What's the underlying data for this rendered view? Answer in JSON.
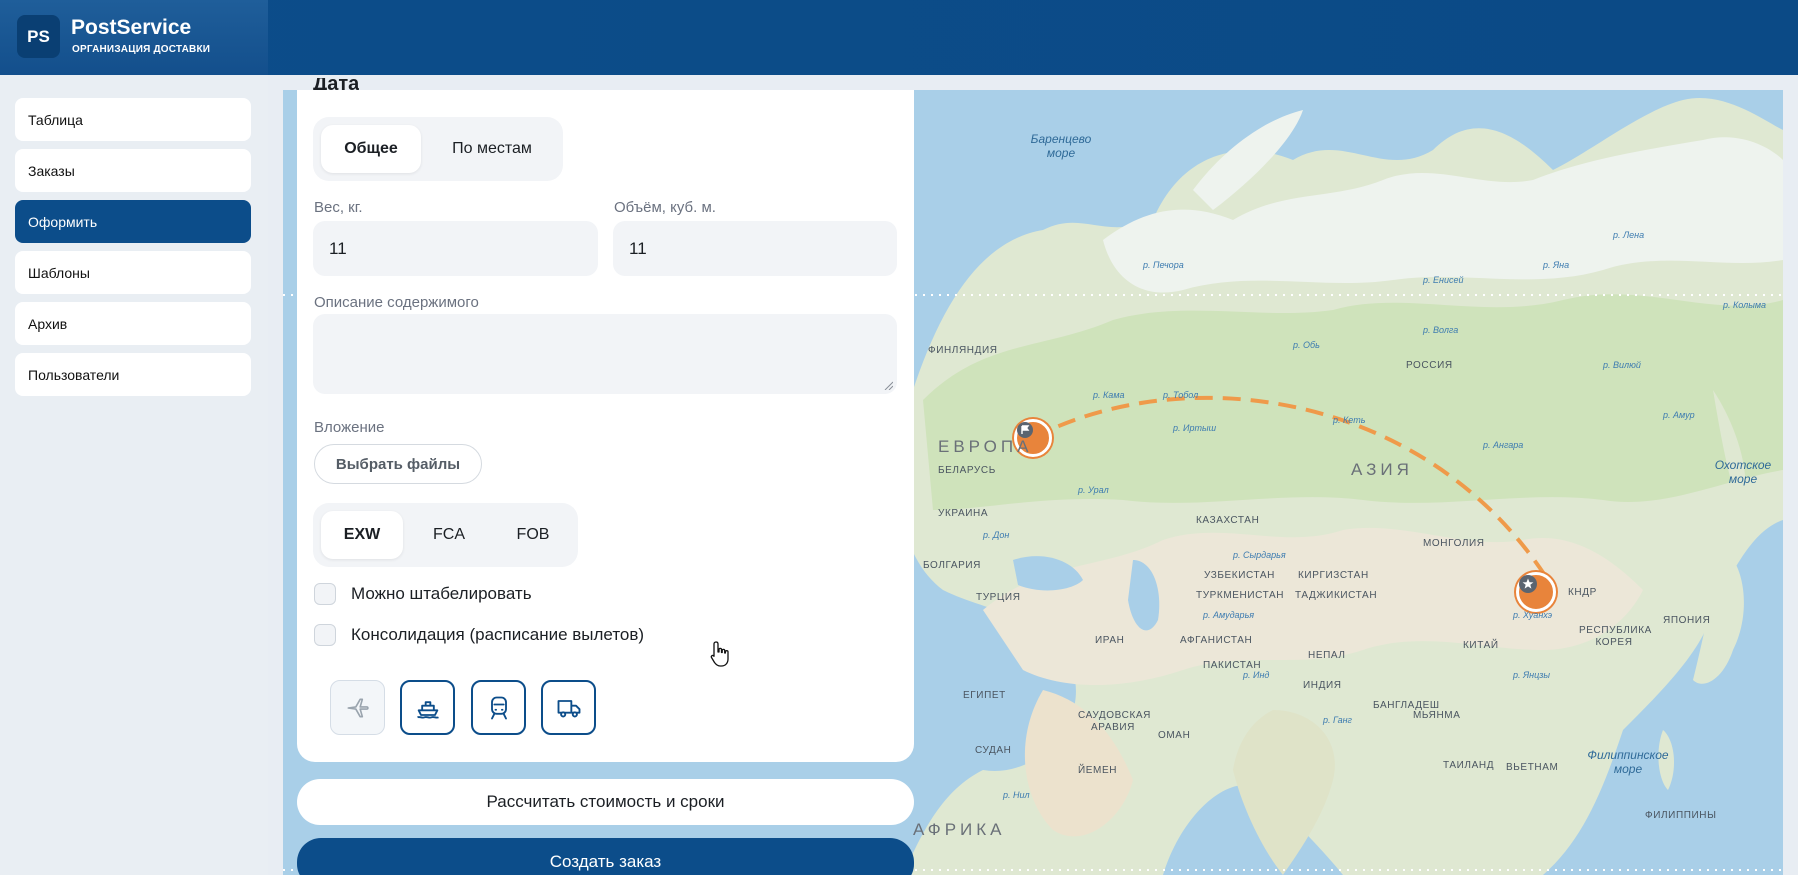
{
  "app": {
    "logo": "PS",
    "name": "PostService",
    "subtitle": "ОРГАНИЗАЦИЯ ДОСТАВКИ"
  },
  "sidebar": {
    "items": [
      {
        "label": "Таблица",
        "active": false
      },
      {
        "label": "Заказы",
        "active": false
      },
      {
        "label": "Оформить",
        "active": true
      },
      {
        "label": "Шаблоны",
        "active": false
      },
      {
        "label": "Архив",
        "active": false
      },
      {
        "label": "Пользователи",
        "active": false
      }
    ]
  },
  "form": {
    "cut_title": "Дата",
    "cargo_tabs": [
      {
        "label": "Общее",
        "active": true
      },
      {
        "label": "По местам",
        "active": false
      }
    ],
    "weight": {
      "label": "Вес, кг.",
      "value": "11"
    },
    "volume": {
      "label": "Объём, куб. м.",
      "value": "11"
    },
    "description": {
      "label": "Описание содержимого",
      "value": ""
    },
    "attachment": {
      "label": "Вложение",
      "button": "Выбрать файлы"
    },
    "incoterms": [
      {
        "label": "EXW",
        "active": true
      },
      {
        "label": "FCA",
        "active": false
      },
      {
        "label": "FOB",
        "active": false
      }
    ],
    "checkboxes": [
      {
        "label": "Можно штабелировать",
        "checked": false
      },
      {
        "label": "Консолидация (расписание вылетов)",
        "checked": false
      }
    ],
    "transport": [
      {
        "icon": "plane-icon",
        "enabled": false
      },
      {
        "icon": "ship-icon",
        "enabled": true
      },
      {
        "icon": "train-icon",
        "enabled": true
      },
      {
        "icon": "truck-icon",
        "enabled": true
      }
    ],
    "calc_button": "Рассчитать стоимость и сроки",
    "create_button": "Создать заказ"
  },
  "map": {
    "seas": [
      "Баренцево море",
      "Охотское море",
      "Филиппинское море"
    ],
    "continents": [
      "ЕВРОПА",
      "АЗИЯ",
      "АФРИКА"
    ],
    "countries": [
      "ФИНЛЯНДИЯ",
      "БЕЛАРУСЬ",
      "УКРАИНА",
      "БОЛГАРИЯ",
      "РОССИЯ",
      "КАЗАХСТАН",
      "МОНГОЛИЯ",
      "ТУРЦИЯ",
      "УЗБЕКИСТАН",
      "КИРГИЗСТАН",
      "ТУРКМЕНИСТАН",
      "ТАДЖИКИСТАН",
      "ИРАН",
      "АФГАНИСТАН",
      "ПАКИСТАН",
      "ИНДИЯ",
      "ЕГИПЕТ",
      "САУДОВСКАЯ АРАВИЯ",
      "СУДАН",
      "ЙЕМЕН",
      "ОМАН",
      "ТАИЛАНД",
      "ВЬЕТНАМ",
      "ФИЛИППИНЫ",
      "НЕПАЛ",
      "БАНГЛАДЕШ",
      "МЬЯНМА",
      "КИТАЙ",
      "РЕСПУБЛИКА КОРЕЯ",
      "ЯПОНИЯ",
      "КНДР"
    ],
    "rivers": [
      "р. Волга",
      "р. Обь",
      "р. Енисей",
      "р. Лена",
      "р. Амур",
      "р. Иртыш",
      "р. Урал",
      "р. Яна",
      "р. Колыма",
      "р. Кеть",
      "р. Печора",
      "р. Кама",
      "р. Вилюй",
      "р. Ангара",
      "р. Тобол",
      "р. Дон",
      "р. Инд",
      "р. Ганг",
      "р. Нил",
      "р. Хуанхэ",
      "р. Янцзы",
      "р. Сырдарья",
      "р. Амударья"
    ],
    "origin_icon": "flag-icon",
    "destination_icon": "star-icon",
    "colors": {
      "route": "#ef9a4a",
      "marker": "#e8843b",
      "sea": "#a9cfe8",
      "land": "#dfe8d2"
    }
  }
}
